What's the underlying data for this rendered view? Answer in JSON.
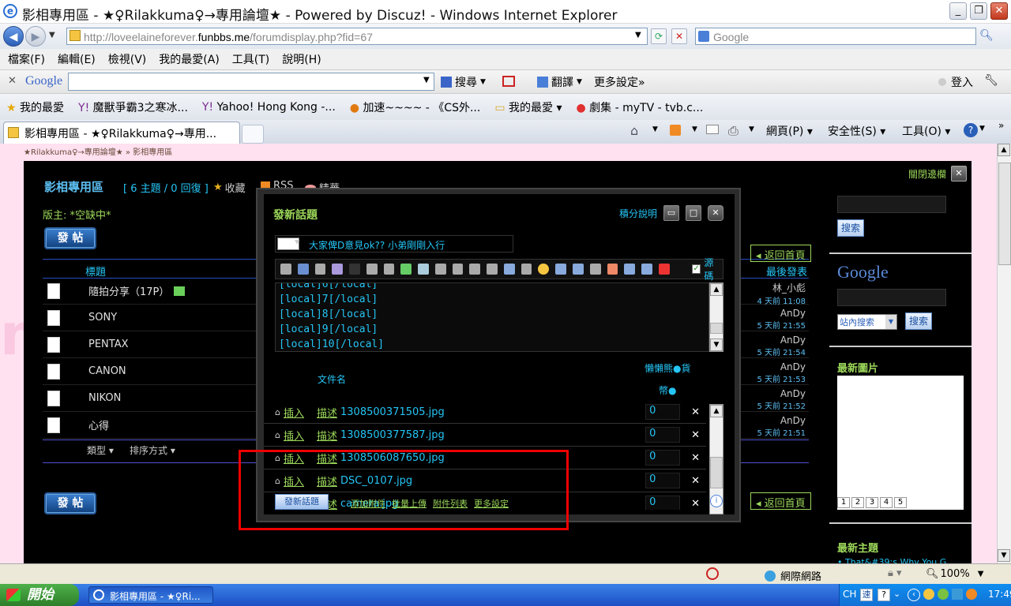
{
  "window": {
    "title": "影相專用區 - ★♀Rilakkuma♀→專用論壇★ - Powered by Discuz! - Windows Internet Explorer",
    "controls": {
      "minimize": "_",
      "maximize": "❐",
      "close": "✕"
    }
  },
  "address": {
    "url_prefix": "http://loveelaineforever.",
    "url_domain": "funbbs.me",
    "url_path": "/forumdisplay.php?fid=67",
    "search_placeholder": "Google"
  },
  "menu": [
    "檔案(F)",
    "編輯(E)",
    "檢視(V)",
    "我的最愛(A)",
    "工具(T)",
    "說明(H)"
  ],
  "google_toolbar": {
    "logo": "Google",
    "search_label": "搜尋",
    "translate_label": "翻譯",
    "more_settings": "更多設定»",
    "login": "登入"
  },
  "favorites": {
    "label": "我的最愛",
    "items": [
      "魔獸爭霸3之寒冰...",
      "Yahoo! Hong Kong -...",
      "加速~~~~ - 《CS外...",
      "我的最愛",
      "劇集 - myTV - tvb.c..."
    ]
  },
  "tab": {
    "title": "影相專用區 - ★♀Rilakkuma♀→專用...",
    "cmd": {
      "page": "網頁(P)",
      "safety": "安全性(S)",
      "tools": "工具(O)"
    }
  },
  "forum": {
    "breadcrumb": "★Rilakkuma♀→專用論壇★ » 影相專用區",
    "title": "影相專用區",
    "stats": "[ 6 主題 / 0 回復 ]",
    "favorite": "收藏",
    "rss": "RSS",
    "digest": "精華",
    "moderator": "版主: *空缺中*",
    "post_button": "發 帖",
    "col_title": "標題",
    "col_last": "最後發表",
    "close_sidebar": "關閉邊欄",
    "back_home": "返回首頁",
    "type_label": "類型",
    "sort_label": "排序方式",
    "threads": [
      {
        "name": "隨拍分享（17P）",
        "author": "林_小彪",
        "time": "4 天前 11:08"
      },
      {
        "name": "SONY",
        "author": "AnDy",
        "time": "5 天前 21:55"
      },
      {
        "name": "PENTAX",
        "author": "AnDy",
        "time": "5 天前 21:54"
      },
      {
        "name": "CANON",
        "author": "AnDy",
        "time": "5 天前 21:53"
      },
      {
        "name": "NIKON",
        "author": "AnDy",
        "time": "5 天前 21:52"
      },
      {
        "name": "心得",
        "author": "AnDy",
        "time": "5 天前 21:51"
      }
    ],
    "sidebar": {
      "search_btn": "搜索",
      "google_logo": "Google",
      "site_search": "站內搜索",
      "search_btn2": "搜索",
      "latest_pics": "最新圖片",
      "pages": [
        "1",
        "2",
        "3",
        "4",
        "5"
      ],
      "latest_topics": "最新主題",
      "latest_topic_item": "• That&#39;s Why You G"
    }
  },
  "modal": {
    "title": "發新話題",
    "points_help": "積分說明",
    "subject": "大家俾D意見ok?? 小弟剛剛入行",
    "source_label": "源碼",
    "editor_lines": [
      "[local]6[/local]",
      "[local]7[/local]",
      "[local]8[/local]",
      "[local]9[/local]",
      "[local]10[/local]"
    ],
    "col_filename": "文件名",
    "col_price_1": "懶懶熊●貨",
    "col_price_2": "幣●",
    "insert_label": "插入",
    "desc_label": "描述",
    "attachments": [
      {
        "file": "1308500371505.jpg",
        "price": "0"
      },
      {
        "file": "1308500377587.jpg",
        "price": "0"
      },
      {
        "file": "1308506087650.jpg",
        "price": "0"
      },
      {
        "file": "DSC_0107.jpg",
        "price": "0"
      },
      {
        "file": "camera.jpg",
        "price": "0"
      }
    ],
    "submit": "發新話題",
    "add_attach": "添加附件",
    "bulk_upload": "批量上傳",
    "attach_list": "附件列表",
    "more_settings": "更多設定"
  },
  "status": {
    "zone": "網際網路",
    "zoom": "100%"
  },
  "taskbar": {
    "start": "開始",
    "window_item": "影相專用區 - ★♀Ri...",
    "lang": "CH",
    "clock": "17:49"
  }
}
